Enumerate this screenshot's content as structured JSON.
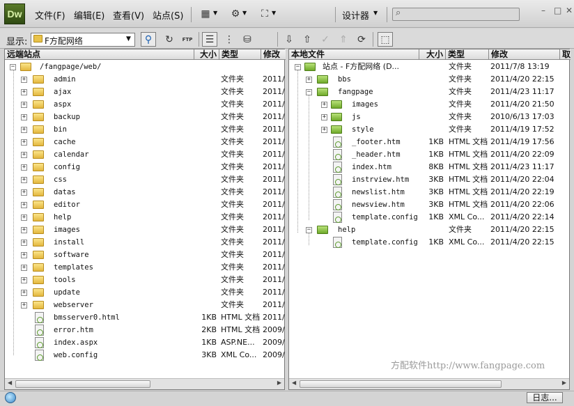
{
  "app": {
    "logo": "Dw",
    "menu": [
      "文件(F)",
      "编辑(E)",
      "查看(V)",
      "站点(S)"
    ],
    "designer_label": "设计器",
    "search_placeholder": "",
    "window_buttons": [
      "–",
      "□",
      "✕"
    ]
  },
  "toolbar": {
    "show_label": "显示:",
    "site_select_value": "F方配网络",
    "tool_icons": [
      "connect-icon",
      "refresh-icon",
      "ftp-log-icon",
      "site-files-icon",
      "testing-server-icon",
      "repository-icon",
      "get-files-icon",
      "put-files-icon",
      "check-out-icon",
      "check-in-icon",
      "synchronize-icon",
      "expand-collapse-icon"
    ],
    "ftp_label": "FTP"
  },
  "remote_pane": {
    "columns": [
      "远端站点",
      "大小",
      "类型",
      "修改"
    ],
    "root": "/fangpage/web/",
    "folder_type": "文件夹",
    "folders": [
      {
        "name": "admin",
        "modified": "2011/"
      },
      {
        "name": "ajax",
        "modified": "2011/"
      },
      {
        "name": "aspx",
        "modified": "2011/"
      },
      {
        "name": "backup",
        "modified": "2011/"
      },
      {
        "name": "bin",
        "modified": "2011/"
      },
      {
        "name": "cache",
        "modified": "2011/"
      },
      {
        "name": "calendar",
        "modified": "2011/"
      },
      {
        "name": "config",
        "modified": "2011/"
      },
      {
        "name": "css",
        "modified": "2011/"
      },
      {
        "name": "datas",
        "modified": "2011/"
      },
      {
        "name": "editor",
        "modified": "2011/"
      },
      {
        "name": "help",
        "modified": "2011/"
      },
      {
        "name": "images",
        "modified": "2011/"
      },
      {
        "name": "install",
        "modified": "2011/"
      },
      {
        "name": "software",
        "modified": "2011/"
      },
      {
        "name": "templates",
        "modified": "2011/"
      },
      {
        "name": "tools",
        "modified": "2011/"
      },
      {
        "name": "update",
        "modified": "2011/"
      },
      {
        "name": "webserver",
        "modified": "2011/"
      }
    ],
    "files": [
      {
        "name": "bmsserver0.html",
        "size": "1KB",
        "type": "HTML 文档",
        "modified": "2011/"
      },
      {
        "name": "error.htm",
        "size": "2KB",
        "type": "HTML 文档",
        "modified": "2009/"
      },
      {
        "name": "index.aspx",
        "size": "1KB",
        "type": "ASP.NE...",
        "modified": "2009/"
      },
      {
        "name": "web.config",
        "size": "3KB",
        "type": "XML Co...",
        "modified": "2009/"
      }
    ]
  },
  "local_pane": {
    "columns": [
      "本地文件",
      "大小",
      "类型",
      "修改",
      "取"
    ],
    "rows": [
      {
        "level": 0,
        "kind": "site",
        "expander": "−",
        "name": "站点 - F方配网络 (D...",
        "size": "",
        "type": "文件夹",
        "modified": "2011/7/8 13:19"
      },
      {
        "level": 1,
        "kind": "folder",
        "expander": "+",
        "name": "bbs",
        "size": "",
        "type": "文件夹",
        "modified": "2011/4/20 22:15"
      },
      {
        "level": 1,
        "kind": "folder",
        "expander": "−",
        "name": "fangpage",
        "size": "",
        "type": "文件夹",
        "modified": "2011/4/23 11:17"
      },
      {
        "level": 2,
        "kind": "folder",
        "expander": "+",
        "name": "images",
        "size": "",
        "type": "文件夹",
        "modified": "2011/4/20 21:50"
      },
      {
        "level": 2,
        "kind": "folder",
        "expander": "+",
        "name": "js",
        "size": "",
        "type": "文件夹",
        "modified": "2010/6/13 17:03"
      },
      {
        "level": 2,
        "kind": "folder",
        "expander": "+",
        "name": "style",
        "size": "",
        "type": "文件夹",
        "modified": "2011/4/19 17:52"
      },
      {
        "level": 2,
        "kind": "file",
        "expander": "",
        "name": "_footer.htm",
        "size": "1KB",
        "type": "HTML 文档",
        "modified": "2011/4/19 17:56"
      },
      {
        "level": 2,
        "kind": "file",
        "expander": "",
        "name": "_header.htm",
        "size": "1KB",
        "type": "HTML 文档",
        "modified": "2011/4/20 22:09"
      },
      {
        "level": 2,
        "kind": "file",
        "expander": "",
        "name": "index.htm",
        "size": "8KB",
        "type": "HTML 文档",
        "modified": "2011/4/23 11:17"
      },
      {
        "level": 2,
        "kind": "file",
        "expander": "",
        "name": "instrview.htm",
        "size": "3KB",
        "type": "HTML 文档",
        "modified": "2011/4/20 22:04"
      },
      {
        "level": 2,
        "kind": "file",
        "expander": "",
        "name": "newslist.htm",
        "size": "3KB",
        "type": "HTML 文档",
        "modified": "2011/4/20 22:19"
      },
      {
        "level": 2,
        "kind": "file",
        "expander": "",
        "name": "newsview.htm",
        "size": "3KB",
        "type": "HTML 文档",
        "modified": "2011/4/20 22:06"
      },
      {
        "level": 2,
        "kind": "file",
        "expander": "",
        "name": "template.config",
        "size": "1KB",
        "type": "XML Co...",
        "modified": "2011/4/20 22:14"
      },
      {
        "level": 1,
        "kind": "folder",
        "expander": "−",
        "name": "help",
        "size": "",
        "type": "文件夹",
        "modified": "2011/4/20 22:15"
      },
      {
        "level": 2,
        "kind": "file",
        "expander": "",
        "name": "template.config",
        "size": "1KB",
        "type": "XML Co...",
        "modified": "2011/4/20 22:15"
      }
    ]
  },
  "watermark": "方配软件http://www.fangpage.com",
  "status": {
    "log_button": "日志..."
  },
  "colors": {
    "folder_yellow": "#e3b73e",
    "folder_green": "#6faa2a",
    "logo_bg": "#3f5d1a"
  }
}
